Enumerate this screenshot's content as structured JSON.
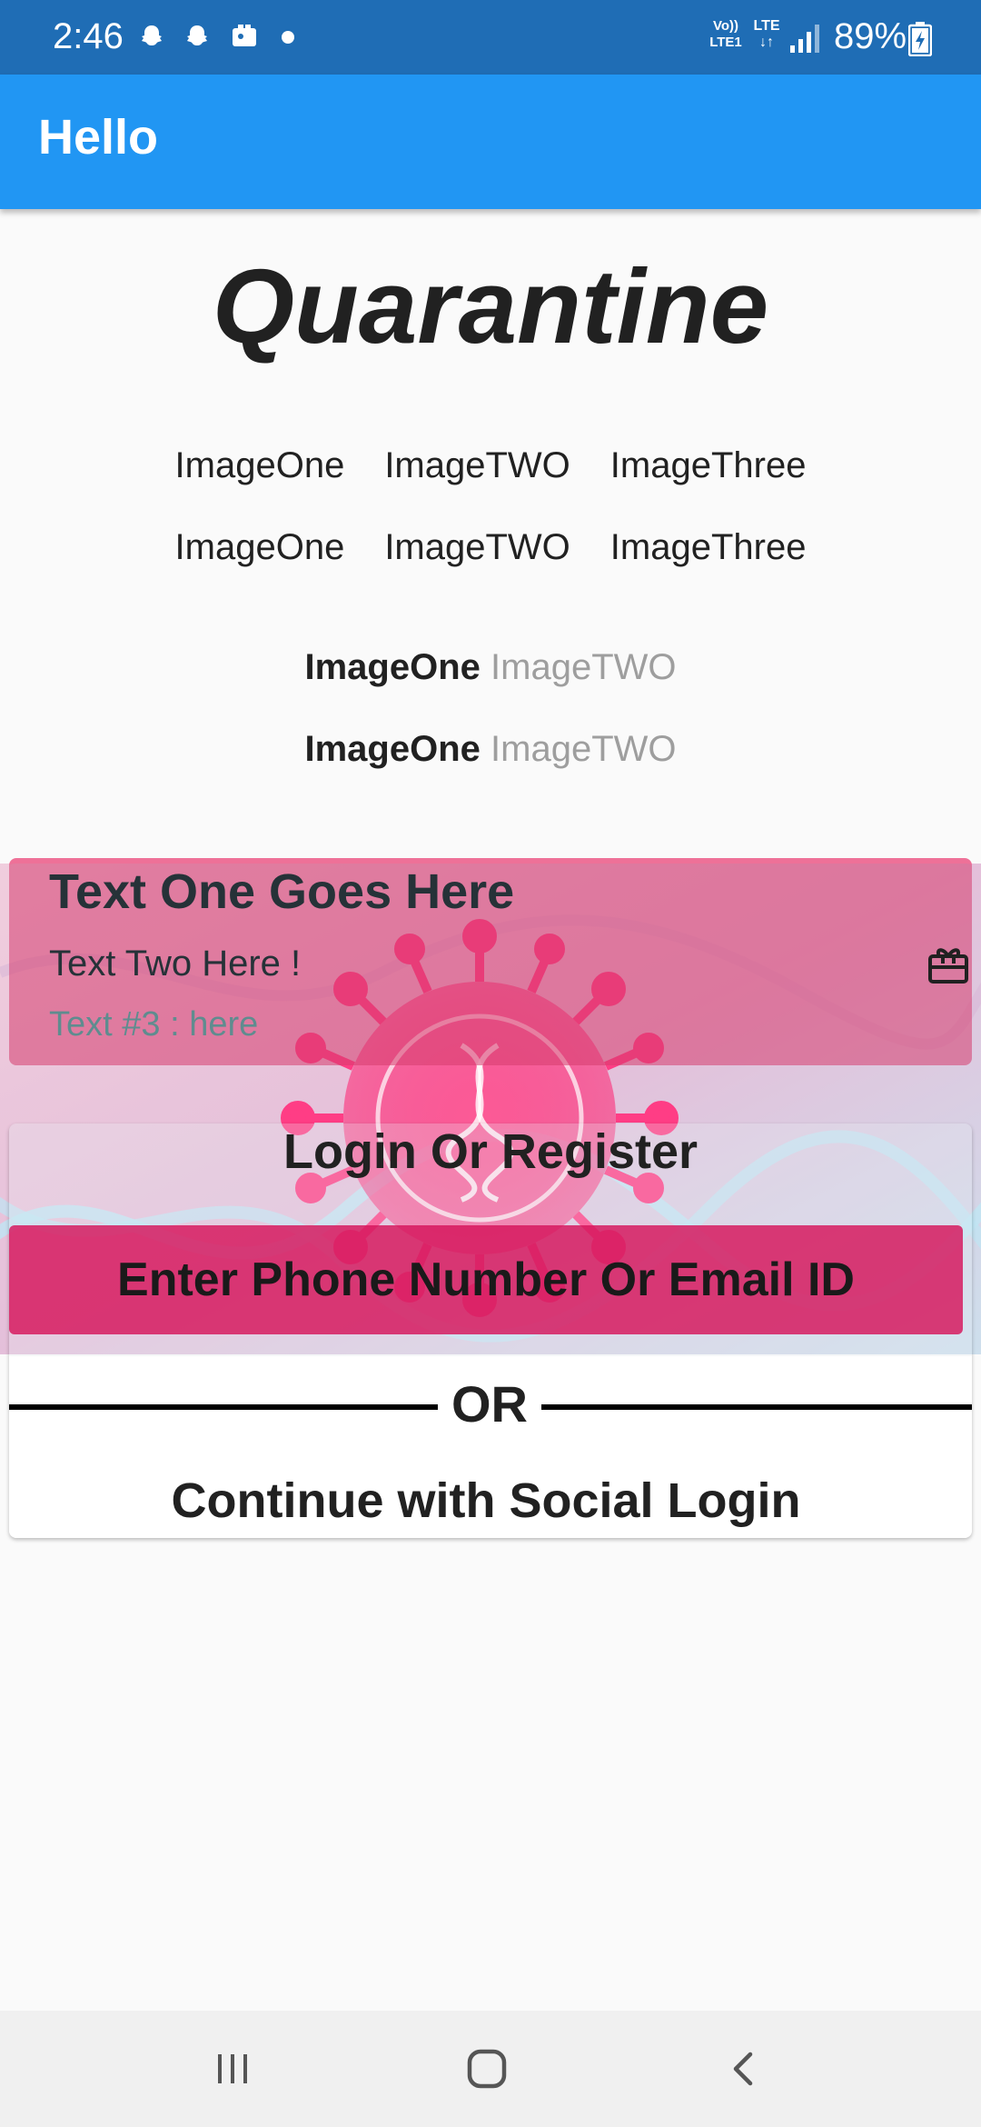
{
  "status_bar": {
    "time": "2:46",
    "volte_label": "Vo)) LTE1",
    "lte_label": "LTE",
    "battery": "89%",
    "notification_icons": [
      "snapchat-icon",
      "snapchat-icon",
      "gallery-icon"
    ]
  },
  "app_bar": {
    "title": "Hello"
  },
  "main": {
    "title": "Quarantine",
    "image_rows": [
      [
        "ImageOne",
        "ImageTWO",
        "ImageThree"
      ],
      [
        "ImageOne",
        "ImageTWO",
        "ImageThree"
      ]
    ],
    "mixed_rows": [
      {
        "bold": "ImageOne",
        "grey": "ImageTWO"
      },
      {
        "bold": "ImageOne",
        "grey": "ImageTWO"
      }
    ]
  },
  "card": {
    "text_one": "Text One Goes Here",
    "text_two": "Text Two Here !",
    "text_three": "Text #3 : here",
    "icon": "gift-card-icon"
  },
  "login": {
    "title": "Login Or Register",
    "phone_email_button": "Enter Phone Number Or Email ID",
    "or_text": "OR",
    "social_login": "Continue with Social Login"
  },
  "nav_bar": {
    "buttons": [
      "recent-apps-icon",
      "home-icon",
      "back-icon"
    ]
  },
  "colors": {
    "status_bar": "#1f6db5",
    "app_bar": "#2196f3",
    "card": "#d63c6e",
    "button": "#d6145a"
  }
}
